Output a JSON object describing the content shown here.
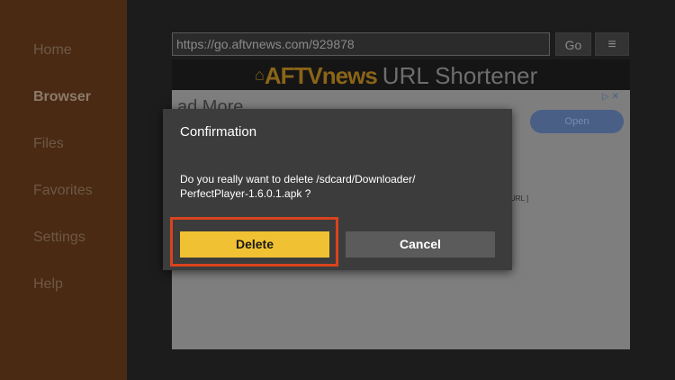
{
  "sidebar": {
    "items": [
      {
        "label": "Home"
      },
      {
        "label": "Browser"
      },
      {
        "label": "Files"
      },
      {
        "label": "Favorites"
      },
      {
        "label": "Settings"
      },
      {
        "label": "Help"
      }
    ]
  },
  "toolbar": {
    "url": "https://go.aftvnews.com/929878",
    "go_label": "Go",
    "menu_icon": "≡"
  },
  "page": {
    "logo_brand": "AFTVnews",
    "logo_tagline": "URL Shortener",
    "ad_text": "ad More",
    "ad_button": "Open",
    "ad_close": "▷ ✕",
    "fragment": "URL ]"
  },
  "dialog": {
    "title": "Confirmation",
    "message": "Do you really want to delete /sdcard/Downloader/\nPerfectPlayer-1.6.0.1.apk ?",
    "delete_label": "Delete",
    "cancel_label": "Cancel"
  },
  "colors": {
    "sidebar_bg": "#4a2a13",
    "delete_bg": "#f0c132",
    "highlight": "#d9431d",
    "dialog_bg": "#3c3c3c"
  }
}
